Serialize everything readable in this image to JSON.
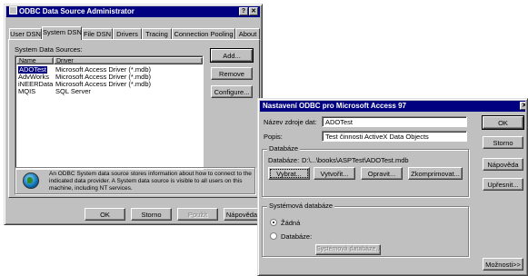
{
  "admin": {
    "title": "ODBC Data Source Administrator",
    "title_buttons": [
      "?",
      "✕"
    ],
    "tabs": [
      "User DSN",
      "System DSN",
      "File DSN",
      "Drivers",
      "Tracing",
      "Connection Pooling",
      "About"
    ],
    "list_label": "System Data Sources:",
    "columns": [
      "Name",
      "Driver"
    ],
    "rows": [
      {
        "name": "ADOTest",
        "driver": "Microsoft Access Driver (*.mdb)"
      },
      {
        "name": "AdvWorks",
        "driver": "Microsoft Access Driver (*.mdb)"
      },
      {
        "name": "iNEERData",
        "driver": "Microsoft Access Driver (*.mdb)"
      },
      {
        "name": "MQIS",
        "driver": "SQL Server"
      }
    ],
    "side_buttons": [
      "Add...",
      "Remove",
      "Configure..."
    ],
    "info_text": "An ODBC System data source stores information about how to connect to the indicated data provider.  A System data source is visible to all users on this machine, including NT services.",
    "bottom_buttons": [
      "OK",
      "Storno",
      "Použít",
      "Nápověda"
    ]
  },
  "setup": {
    "title": "Nastavení ODBC pro Microsoft Access 97",
    "title_button": "✕",
    "dsn_label": "Název zdroje dat:",
    "dsn_value": "ADOTest",
    "desc_label": "Popis:",
    "desc_value": "Test činnosti ActiveX Data Objects",
    "db_group": "Databáze",
    "db_path_label": "Databáze:",
    "db_path": "D:\\...\\books\\ASPTest\\ADOTest.mdb",
    "db_buttons": [
      "Vybrat...",
      "Vytvořit...",
      "Opravit...",
      "Zkomprimovat..."
    ],
    "sys_group": "Systémová databáze",
    "radio_none": "Žádná",
    "radio_db": "Databáze:",
    "sys_db_button": "Systémová databáze...",
    "right_buttons": [
      "OK",
      "Storno",
      "Nápověda",
      "Upřesnit..."
    ],
    "options_button": "Možnosti>>"
  }
}
